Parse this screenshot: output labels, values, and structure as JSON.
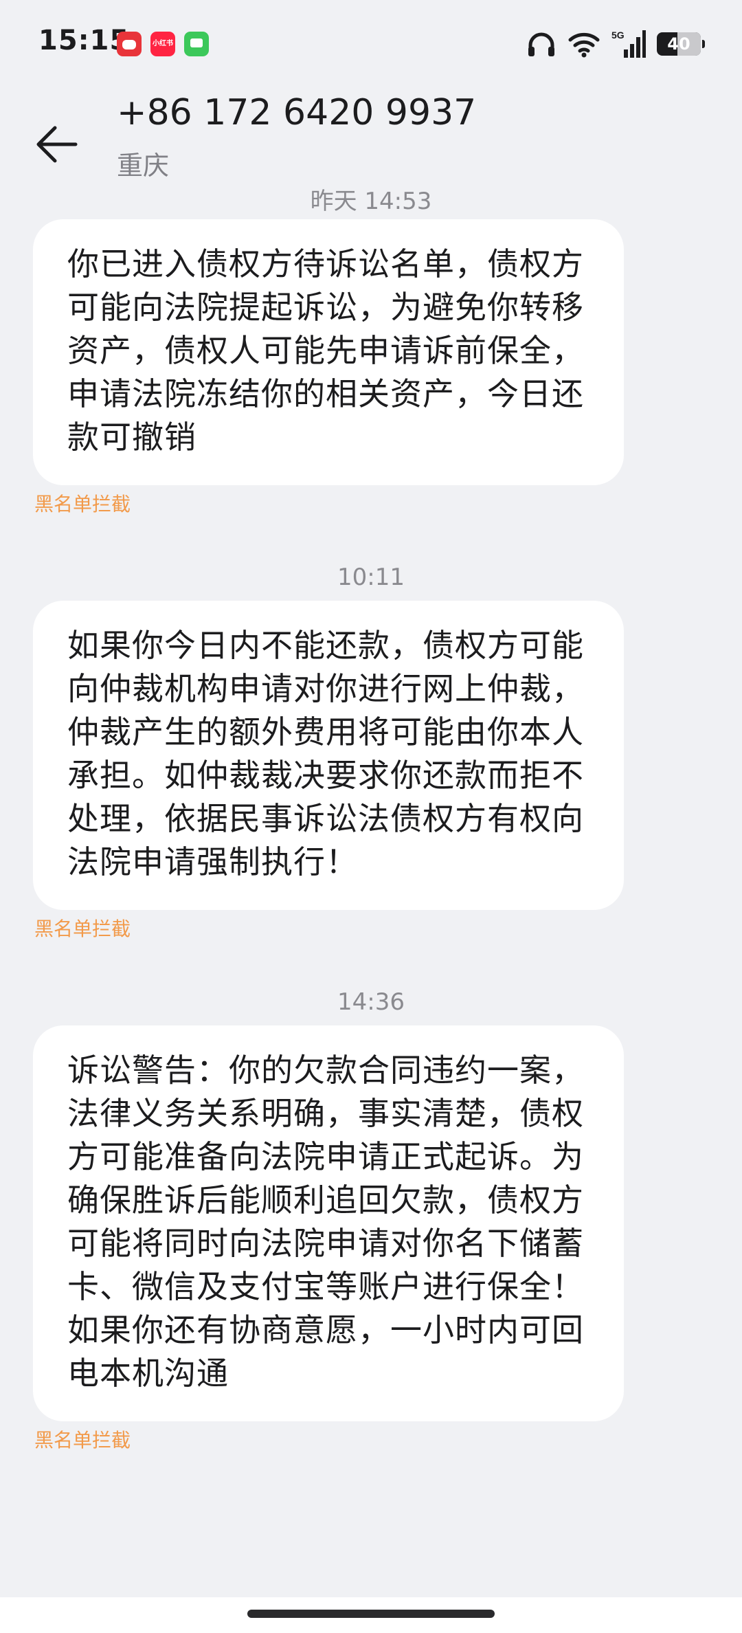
{
  "status_bar": {
    "time": "15:15",
    "app_icons": [
      "red-app-icon",
      "xiaohongshu-icon",
      "messages-app-icon"
    ],
    "app2_label": "小红书",
    "indicators": [
      "headphones-icon",
      "wifi-icon",
      "cellular-5g-icon"
    ],
    "network": "5G",
    "battery": "40"
  },
  "header": {
    "number": "+86 172 6420 9937",
    "location": "重庆"
  },
  "messages": [
    {
      "time": "昨天 14:53",
      "text": "你已进入债权方待诉讼名单，债权方可能向法院提起诉讼，为避免你转移资产，债权人可能先申请诉前保全，申请法院冻结你的相关资产，今日还款可撤销",
      "tag": "黑名单拦截"
    },
    {
      "time": "10:11",
      "text": "如果你今日内不能还款，债权方可能向仲裁机构申请对你进行网上仲裁，仲裁产生的额外费用将可能由你本人承担。如仲裁裁决要求你还款而拒不处理，依据民事诉讼法债权方有权向法院申请强制执行！",
      "tag": "黑名单拦截"
    },
    {
      "time": "14:36",
      "text": "诉讼警告：你的欠款合同违约一案，法律义务关系明确，事实清楚，债权方可能准备向法院申请正式起诉。为确保胜诉后能顺利追回欠款，债权方可能将同时向法院申请对你名下储蓄卡、微信及支付宝等账户进行保全！如果你还有协商意愿，一小时内可回电本机沟通",
      "tag": "黑名单拦截"
    }
  ],
  "colors": {
    "background": "#f0f1f4",
    "bubble": "#ffffff",
    "blocked_tag": "#f29a4a"
  }
}
